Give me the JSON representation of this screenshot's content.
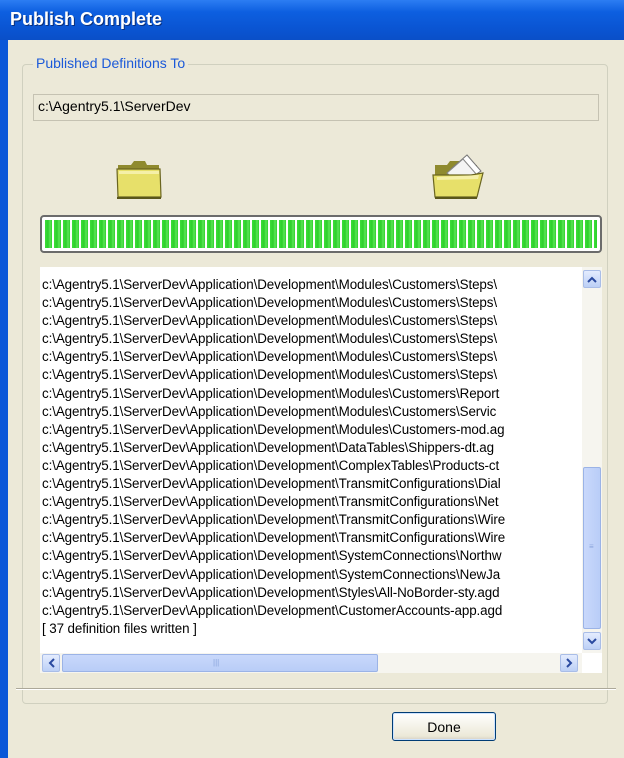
{
  "window": {
    "title": "Publish Complete"
  },
  "group": {
    "label": "Published Definitions To"
  },
  "destination": {
    "path": "c:\\Agentry5.1\\ServerDev"
  },
  "progress": {
    "fraction": 1.0
  },
  "log": {
    "lines": [
      "c:\\Agentry5.1\\ServerDev\\Application\\Development\\Modules\\Customers\\Steps\\",
      "c:\\Agentry5.1\\ServerDev\\Application\\Development\\Modules\\Customers\\Steps\\",
      "c:\\Agentry5.1\\ServerDev\\Application\\Development\\Modules\\Customers\\Steps\\",
      "c:\\Agentry5.1\\ServerDev\\Application\\Development\\Modules\\Customers\\Steps\\",
      "c:\\Agentry5.1\\ServerDev\\Application\\Development\\Modules\\Customers\\Steps\\",
      "c:\\Agentry5.1\\ServerDev\\Application\\Development\\Modules\\Customers\\Steps\\",
      "c:\\Agentry5.1\\ServerDev\\Application\\Development\\Modules\\Customers\\Report",
      "c:\\Agentry5.1\\ServerDev\\Application\\Development\\Modules\\Customers\\Servic",
      "c:\\Agentry5.1\\ServerDev\\Application\\Development\\Modules\\Customers-mod.ag",
      "c:\\Agentry5.1\\ServerDev\\Application\\Development\\DataTables\\Shippers-dt.ag",
      "c:\\Agentry5.1\\ServerDev\\Application\\Development\\ComplexTables\\Products-ct",
      "c:\\Agentry5.1\\ServerDev\\Application\\Development\\TransmitConfigurations\\Dial",
      "c:\\Agentry5.1\\ServerDev\\Application\\Development\\TransmitConfigurations\\Net",
      "c:\\Agentry5.1\\ServerDev\\Application\\Development\\TransmitConfigurations\\Wire",
      "c:\\Agentry5.1\\ServerDev\\Application\\Development\\TransmitConfigurations\\Wire",
      "c:\\Agentry5.1\\ServerDev\\Application\\Development\\SystemConnections\\Northw",
      "c:\\Agentry5.1\\ServerDev\\Application\\Development\\SystemConnections\\NewJa",
      "c:\\Agentry5.1\\ServerDev\\Application\\Development\\Styles\\All-NoBorder-sty.agd",
      "c:\\Agentry5.1\\ServerDev\\Application\\Development\\CustomerAccounts-app.agd",
      "[ 37 definition files written ]"
    ]
  },
  "buttons": {
    "done": "Done"
  },
  "icons": {
    "source": "folder-closed-icon",
    "target": "folder-open-icon",
    "scroll_up": "arrow-up-icon",
    "scroll_down": "arrow-down-icon",
    "scroll_left": "arrow-left-icon",
    "scroll_right": "arrow-right-icon"
  },
  "colors": {
    "title_bar": "#0a57d8",
    "progress": "#34d631",
    "group_label": "#1c5ad9"
  }
}
